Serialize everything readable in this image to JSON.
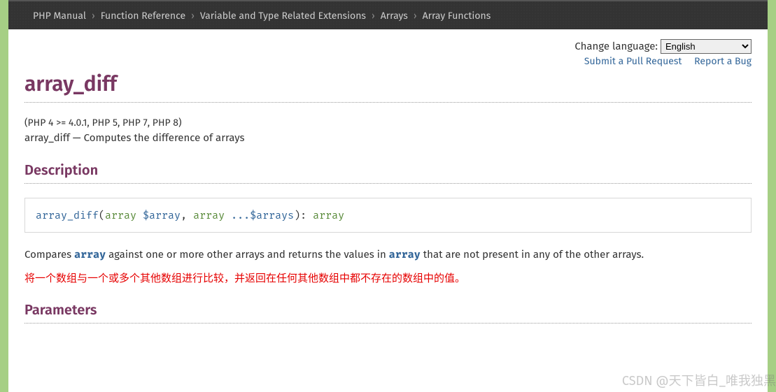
{
  "breadcrumb": {
    "items": [
      "PHP Manual",
      "Function Reference",
      "Variable and Type Related Extensions",
      "Arrays",
      "Array Functions"
    ],
    "sep": "›"
  },
  "lang": {
    "label": "Change language:",
    "selected": "English"
  },
  "links": {
    "pull": "Submit a Pull Request",
    "bug": "Report a Bug"
  },
  "title": "array_diff",
  "version": "(PHP 4 >= 4.0.1, PHP 5, PHP 7, PHP 8)",
  "summary": "array_diff — Computes the difference of arrays",
  "sections": {
    "description": "Description",
    "parameters": "Parameters"
  },
  "signature": {
    "fn": "array_diff",
    "open": "(",
    "p1_type": "array",
    "p1_var": " $array",
    "comma": ", ",
    "p2_type": "array",
    "p2_rest": " ...$arrays",
    "close": "): ",
    "ret": "array"
  },
  "desc": {
    "pre": "Compares ",
    "code1": "array",
    "mid": " against one or more other arrays and returns the values in ",
    "code2": "array",
    "post": " that are not present in any of the other arrays."
  },
  "translated": "将一个数组与一个或多个其他数组进行比较，并返回在任何其他数组中都不存在的数组中的值。",
  "watermark": "CSDN @天下皆白_唯我独黑"
}
